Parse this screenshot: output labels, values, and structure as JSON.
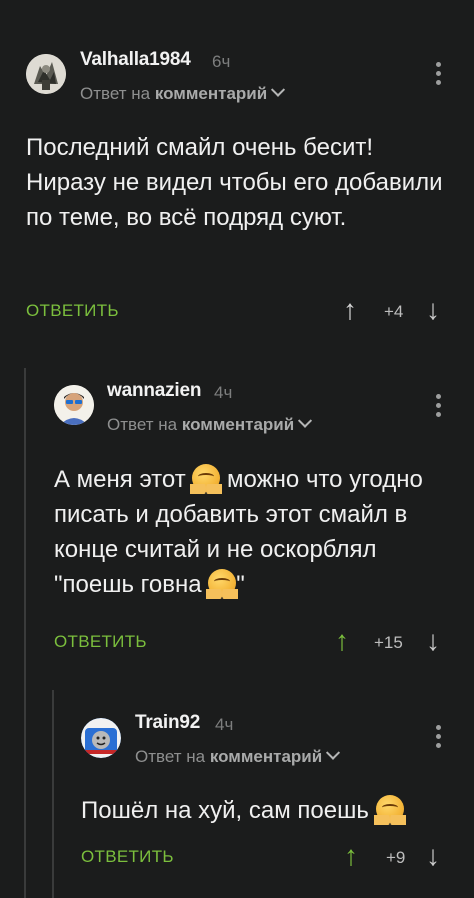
{
  "colors": {
    "background": "#1b1c1c",
    "reply_green": "#7bbf3d",
    "username": "#f2f2f2",
    "meta": "#8e8f8f"
  },
  "comments": [
    {
      "username": "Valhalla1984",
      "time": "6ч",
      "reply_prefix": "Ответ на",
      "reply_target": "комментарий",
      "text": "Последний смайл очень бесит! Ниразу не видел чтобы его добавили по теме, во всё подряд суют.",
      "reply_label": "ОТВЕТИТЬ",
      "score": "+4",
      "upvoted": false
    },
    {
      "username": "wannazien",
      "time": "4ч",
      "reply_prefix": "Ответ на",
      "reply_target": "комментарий",
      "text_part1": "А меня этот",
      "text_part2": "можно что угодно писать и добавить этот смайл в конце считай и не оскорблял \"поешь говна",
      "text_part3": "\"",
      "emoji": "hugging-face-emoji",
      "reply_label": "ОТВЕТИТЬ",
      "score": "+15",
      "upvoted": true
    },
    {
      "username": "Train92",
      "time": "4ч",
      "reply_prefix": "Ответ на",
      "reply_target": "комментарий",
      "text_part1": "Пошёл на хуй, сам поешь",
      "emoji": "hugging-face-emoji",
      "reply_label": "ОТВЕТИТЬ",
      "score": "+9",
      "upvoted": true
    }
  ],
  "icons": {
    "up": "↑",
    "down": "↓",
    "more": "more-vertical-icon"
  }
}
